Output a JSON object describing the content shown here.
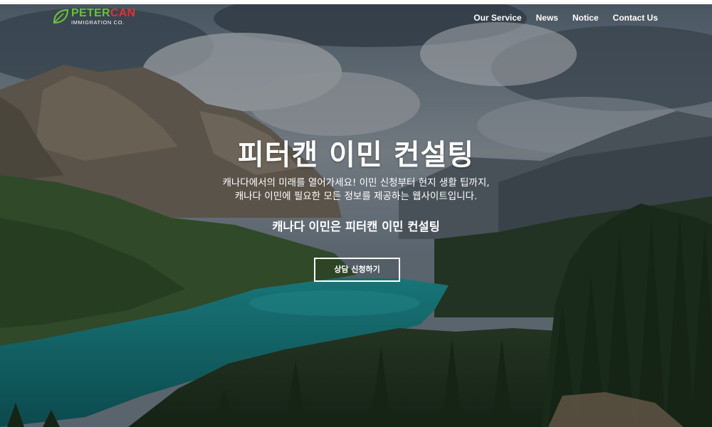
{
  "logo": {
    "brand_part1": "PETER",
    "brand_part2": "CAN",
    "tagline": "IMMIGRATION CO.",
    "icon": "leaf-icon"
  },
  "nav": {
    "items": [
      "Our Service",
      "News",
      "Notice",
      "Contact Us"
    ]
  },
  "hero": {
    "title": "피터캔 이민 컨설팅",
    "description_line1": "캐나다에서의 미래를 열어가세요! 이민 신청부터 현지 생활 팁까지,",
    "description_line2": "캐나다 이민에 필요한 모든 정보를 제공하는 웹사이트입니다.",
    "subtitle": "캐나다 이민은 피터캔 이민 컨설팅",
    "cta_label": "상담 신청하기"
  },
  "colors": {
    "brand_green": "#6bbf3a",
    "brand_red": "#e2322d",
    "lake": "#1e8f92"
  }
}
